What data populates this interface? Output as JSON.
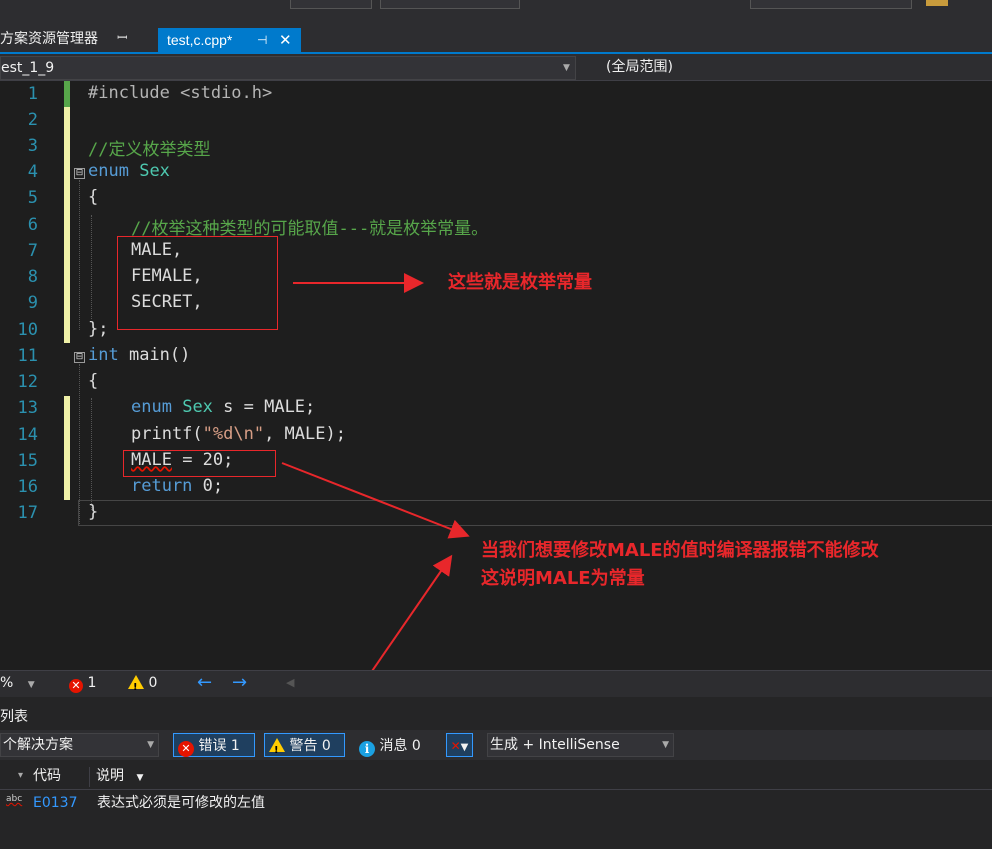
{
  "window": {
    "solution_explorer_tab": "方案资源管理器",
    "solution_explorer_pin": "ꟷ",
    "file_tab": "test,c.cpp*",
    "file_tab_pin": "⊣",
    "file_tab_close": "✕"
  },
  "navbar": {
    "project": "est_1_9",
    "scope": "(全局范围)"
  },
  "editor": {
    "line_numbers": [
      "1",
      "2",
      "3",
      "4",
      "5",
      "6",
      "7",
      "8",
      "9",
      "10",
      "11",
      "12",
      "13",
      "14",
      "15",
      "16",
      "17"
    ],
    "lines": {
      "l1": "#include <stdio.h>",
      "l3": "//定义枚举类型",
      "l4_kw": "enum",
      "l4_ty": "Sex",
      "l5": "{",
      "l6": "//枚举这种类型的可能取值---就是枚举常量。",
      "l7": "MALE,",
      "l8": "FEMALE,",
      "l9": "SECRET,",
      "l10": "};",
      "l11_kw": "int",
      "l11_fn": " main()",
      "l12": "{",
      "l13_kw": "enum",
      "l13_ty": "Sex",
      "l13_rest": " s = MALE;",
      "l14_fn": "printf(",
      "l14_str": "\"%d\\n\"",
      "l14_rest": ", MALE);",
      "l15_var": "MALE",
      "l15_rest": " = 20;",
      "l16_kw": "return",
      "l16_rest": " 0;",
      "l17": "}"
    },
    "fold_markers": [
      "⊟",
      "⊟"
    ]
  },
  "annotations": {
    "note1": "这些就是枚举常量",
    "note2_line1": "当我们想要修改MALE的值时编译器报错不能修改",
    "note2_line2": "这说明MALE为常量",
    "accent_color": "#e8272b"
  },
  "status_strip": {
    "zoom": "%",
    "errors": "1",
    "warnings": "0",
    "back_arrow": "←",
    "forward_arrow": "→"
  },
  "error_list": {
    "title": "列表",
    "scope": "个解决方案",
    "errors_btn": "错误 1",
    "warnings_btn": "警告 0",
    "messages_btn": "消息 0",
    "build_filter": "生成 + IntelliSense",
    "col_code": "代码",
    "col_desc": "说明",
    "rows": [
      {
        "icon": "abc",
        "code": "E0137",
        "desc": "表达式必须是可修改的左值"
      }
    ]
  }
}
